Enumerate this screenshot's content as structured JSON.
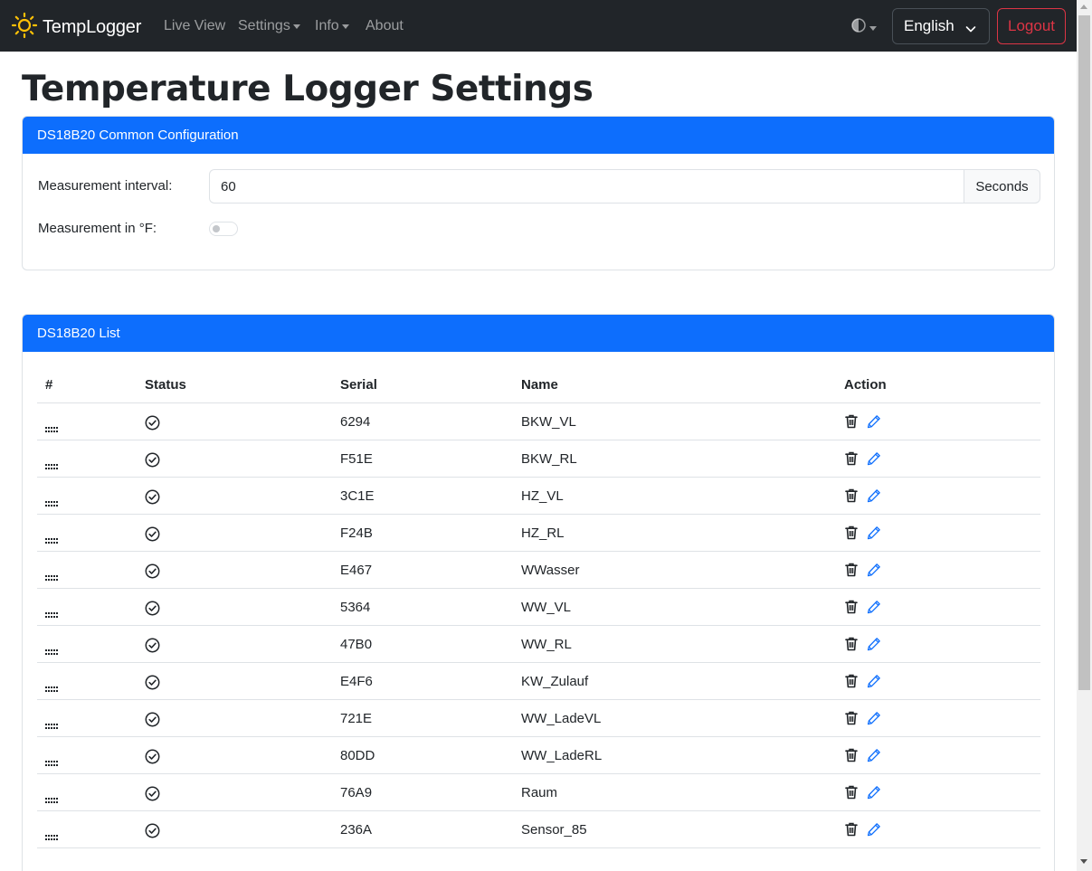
{
  "app": {
    "brand": "TempLogger",
    "nav": [
      {
        "label": "Live View"
      },
      {
        "label": "Settings"
      },
      {
        "label": "Info"
      },
      {
        "label": "About"
      }
    ],
    "language": "English",
    "logout_label": "Logout"
  },
  "page": {
    "title": "Temperature Logger Settings"
  },
  "common_config": {
    "header": "DS18B20 Common Configuration",
    "interval_label": "Measurement interval:",
    "interval_value": "60",
    "interval_unit": "Seconds",
    "fahrenheit_label": "Measurement in °F:",
    "fahrenheit_enabled": false
  },
  "sensor_list": {
    "header": "DS18B20 List",
    "columns": [
      "#",
      "Status",
      "Serial",
      "Name",
      "Action"
    ],
    "rows": [
      {
        "serial": "6294",
        "name": "BKW_VL"
      },
      {
        "serial": "F51E",
        "name": "BKW_RL"
      },
      {
        "serial": "3C1E",
        "name": "HZ_VL"
      },
      {
        "serial": "F24B",
        "name": "HZ_RL"
      },
      {
        "serial": "E467",
        "name": "WWasser"
      },
      {
        "serial": "5364",
        "name": "WW_VL"
      },
      {
        "serial": "47B0",
        "name": "WW_RL"
      },
      {
        "serial": "E4F6",
        "name": "KW_Zulauf"
      },
      {
        "serial": "721E",
        "name": "WW_LadeVL"
      },
      {
        "serial": "80DD",
        "name": "WW_LadeRL"
      },
      {
        "serial": "76A9",
        "name": "Raum"
      },
      {
        "serial": "236A",
        "name": "Sensor_85"
      }
    ]
  },
  "colors": {
    "navbar": "#212529",
    "primary": "#0d6efd",
    "danger": "#dc3545",
    "brand_icon": "#ffc107"
  }
}
